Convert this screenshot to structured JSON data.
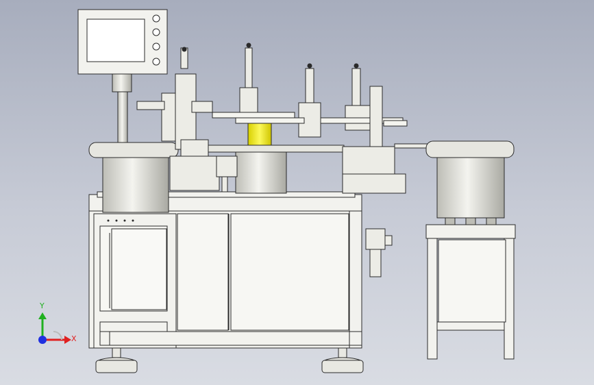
{
  "viewport": {
    "background_top": "#a7adbd",
    "background_bottom": "#d9dce3"
  },
  "machine": {
    "body_color": "#f2f2ee",
    "edge_color": "#2a2a2a",
    "accent_yellow": "#f4f01c",
    "monitor_screen_color": "#ffffff",
    "bowl_color": "#dcdcd6",
    "cylinder_count": 4,
    "feeder_pins": 3
  },
  "triad": {
    "x_label": "X",
    "y_label": "Y",
    "x_color": "#e02020",
    "y_color": "#20b020",
    "origin_color": "#2030e0"
  }
}
